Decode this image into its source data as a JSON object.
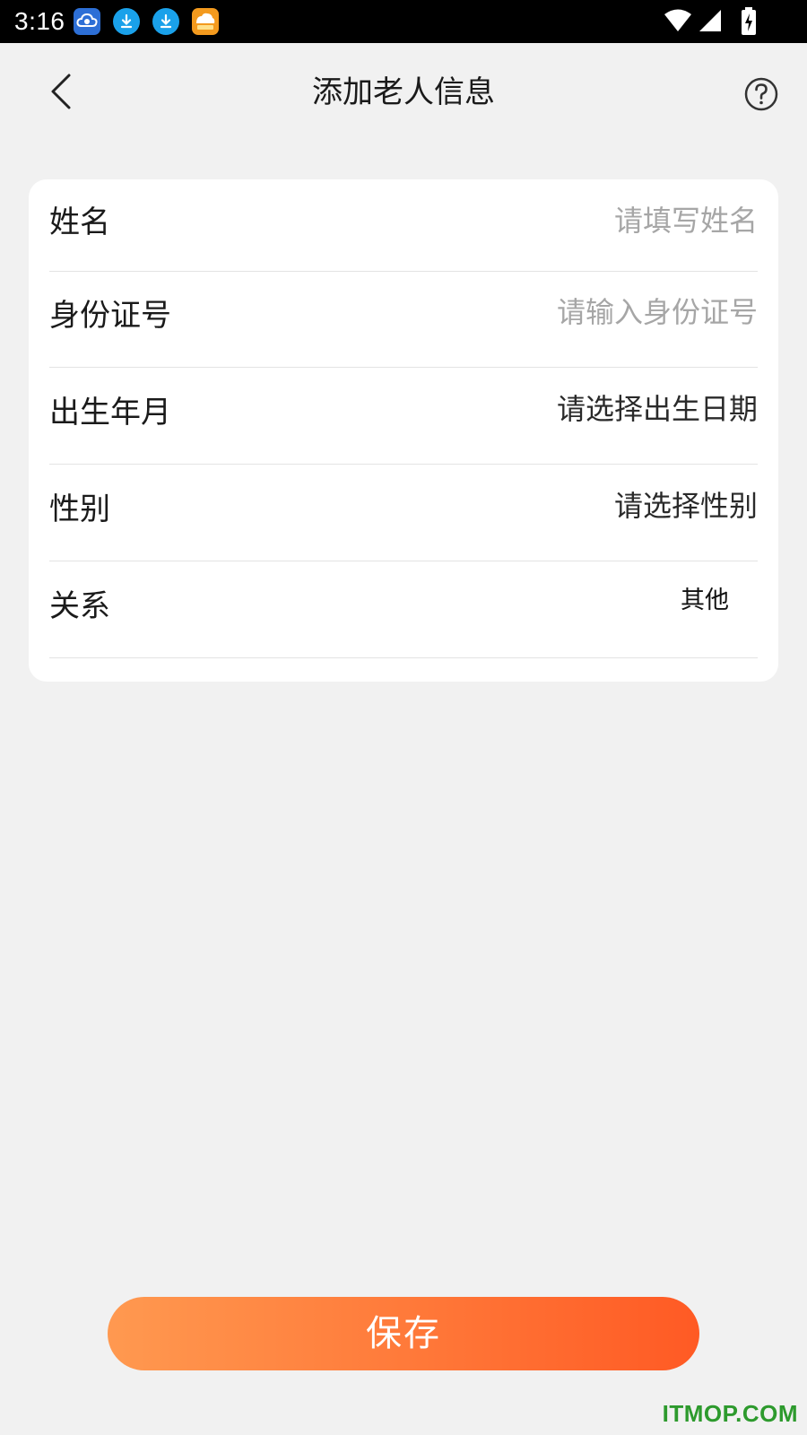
{
  "status_bar": {
    "time": "3:16",
    "notification_icons": [
      "cloud-sync-icon",
      "download-icon",
      "download-icon",
      "orange-app-icon"
    ],
    "system_icons": [
      "wifi-icon",
      "cellular-signal-icon",
      "battery-charging-icon"
    ]
  },
  "header": {
    "title": "添加老人信息",
    "back_icon": "chevron-left-icon",
    "help_icon": "question-circle-icon"
  },
  "form": {
    "rows": [
      {
        "label": "姓名",
        "value": "请填写姓名",
        "state": "placeholder"
      },
      {
        "label": "身份证号",
        "value": "请输入身份证号",
        "state": "placeholder"
      },
      {
        "label": "出生年月",
        "value": "请选择出生日期",
        "state": "filled"
      },
      {
        "label": "性别",
        "value": "请选择性别",
        "state": "filled"
      },
      {
        "label": "关系",
        "value": "其他",
        "state": "selected"
      }
    ]
  },
  "save_button": {
    "label": "保存"
  },
  "watermark": "ITMOP.COM",
  "colors": {
    "background": "#f1f1f1",
    "card": "#ffffff",
    "accent_start": "#ff9950",
    "accent_end": "#ff5a24",
    "placeholder": "#a6a6a6",
    "watermark": "#2d9a2d"
  }
}
